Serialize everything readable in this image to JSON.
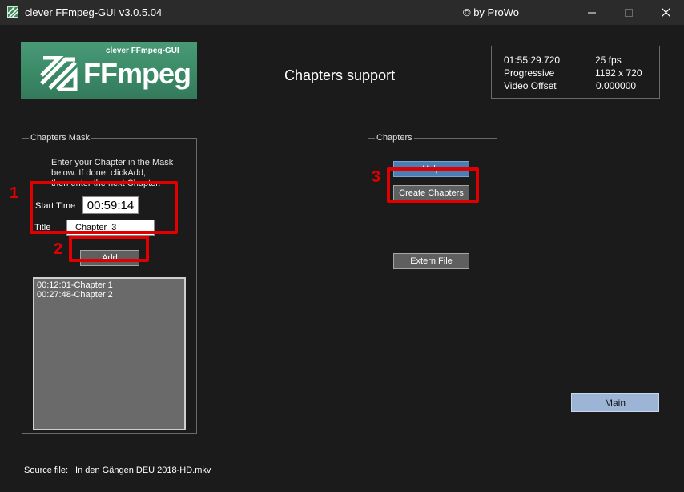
{
  "window": {
    "title": "clever FFmpeg-GUI v3.0.5.04",
    "author": "© by ProWo"
  },
  "logo": {
    "small_text": "clever FFmpeg-GUI",
    "big_text": "FFmpeg"
  },
  "heading": "Chapters support",
  "video_info": {
    "duration": "01:55:29.720",
    "fps": "25 fps",
    "scan": "Progressive",
    "resolution": "1192 x 720",
    "offset_label": "Video Offset",
    "offset_value": "0.000000"
  },
  "chapters_mask": {
    "legend": "Chapters Mask",
    "instructions": [
      "Enter your Chapter in the Mask",
      "below. If done, clickAdd,",
      "then enter the next Chapter."
    ],
    "start_time_label": "Start Time",
    "start_time_value": "00:59:14",
    "title_label": "Title",
    "title_value": "Chapter_3______",
    "add_button": "Add",
    "list": [
      "00:12:01-Chapter 1",
      "00:27:48-Chapter 2"
    ]
  },
  "chapters_panel": {
    "legend": "Chapters",
    "help_button": "Help",
    "create_button": "Create Chapters",
    "extern_button": "Extern File"
  },
  "main_button": "Main",
  "source": {
    "label": "Source file:",
    "filename": "In den Gängen DEU 2018-HD.mkv"
  },
  "annotations": [
    "1",
    "2",
    "3"
  ],
  "colors": {
    "highlight": "#e00000",
    "help_button": "#4a7eb5",
    "main_button": "#9cb4d6",
    "logo_green": "#3b8a66"
  }
}
